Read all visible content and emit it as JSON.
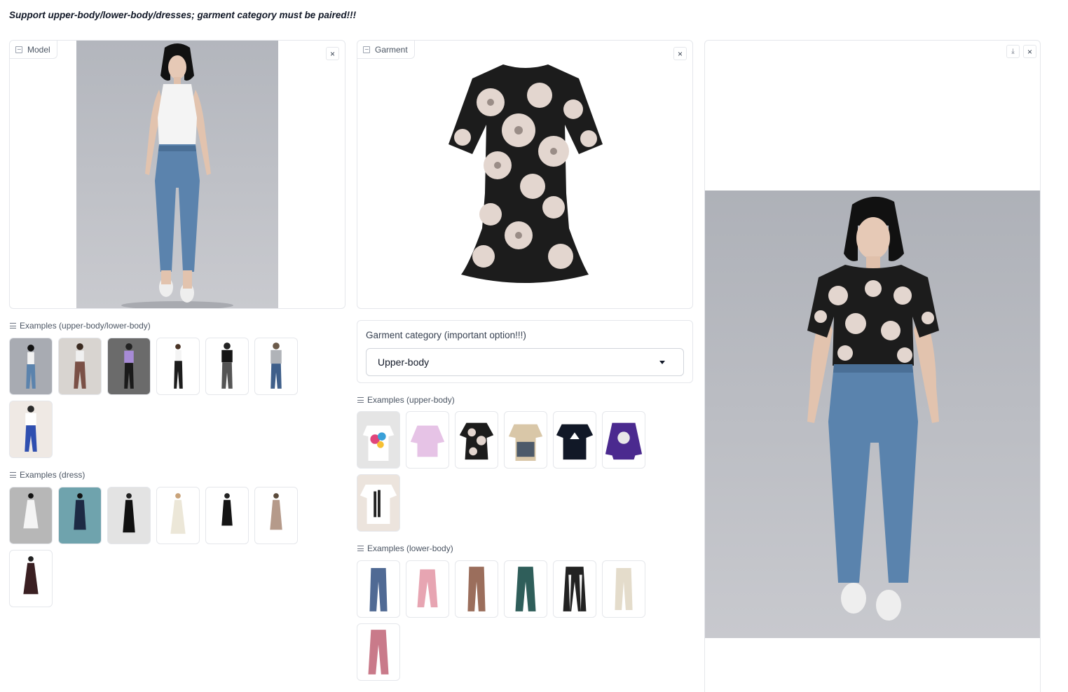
{
  "notice": "Support upper-body/lower-body/dresses; garment category must be paired!!!",
  "model_panel": {
    "label": "Model",
    "close_glyph": "×"
  },
  "garment_panel": {
    "label": "Garment",
    "close_glyph": "×"
  },
  "result_panel": {
    "download_glyph": "⤓",
    "close_glyph": "×"
  },
  "category": {
    "label": "Garment category (important option!!!)",
    "selected": "Upper-body"
  },
  "examples": {
    "models": {
      "title": "Examples (upper-body/lower-body)"
    },
    "dress": {
      "title": "Examples (dress)"
    },
    "upper": {
      "title": "Examples (upper-body)"
    },
    "lower": {
      "title": "Examples (lower-body)"
    }
  },
  "icons": [
    "image-icon",
    "close-icon",
    "download-icon",
    "list-icon",
    "chevron-down-icon"
  ],
  "colors": {
    "border": "#e5e7eb",
    "photo_bg": "#b9bcc3",
    "denim": "#5a83ad",
    "floral_black": "#1c1c1c",
    "floral_petal": "#e3d6cf"
  }
}
